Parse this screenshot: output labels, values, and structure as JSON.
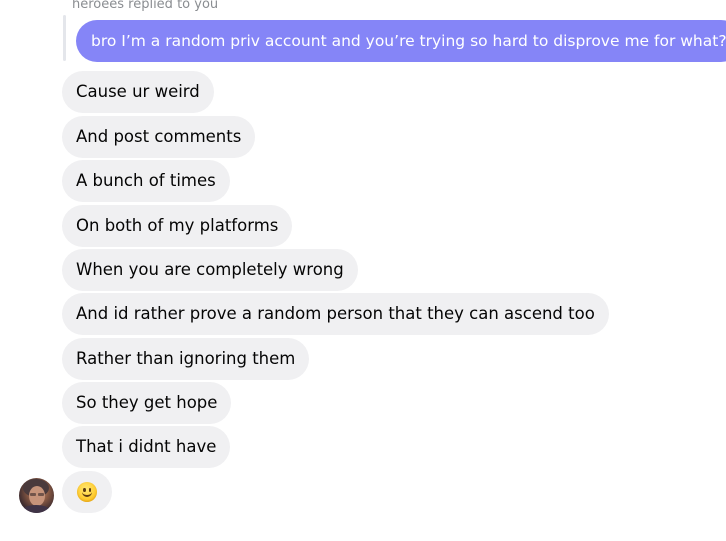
{
  "reply_header": "heroees replied to you",
  "quoted_message": "bro I’m a random priv account and you’re trying so hard to disprove me for what?",
  "messages": [
    "Cause ur weird",
    "And post comments",
    "A bunch of times",
    "On both of my platforms",
    "When you are completely wrong",
    "And id rather prove a random person that they can ascend too",
    "Rather than ignoring them",
    "So they get hope",
    "That i didnt have"
  ],
  "last_message_emoji": "slightly-smiling-face-icon",
  "colors": {
    "sent_bubble": "#8585f7",
    "received_bubble": "#f0f0f2",
    "reply_header_text": "#8a8d91"
  }
}
